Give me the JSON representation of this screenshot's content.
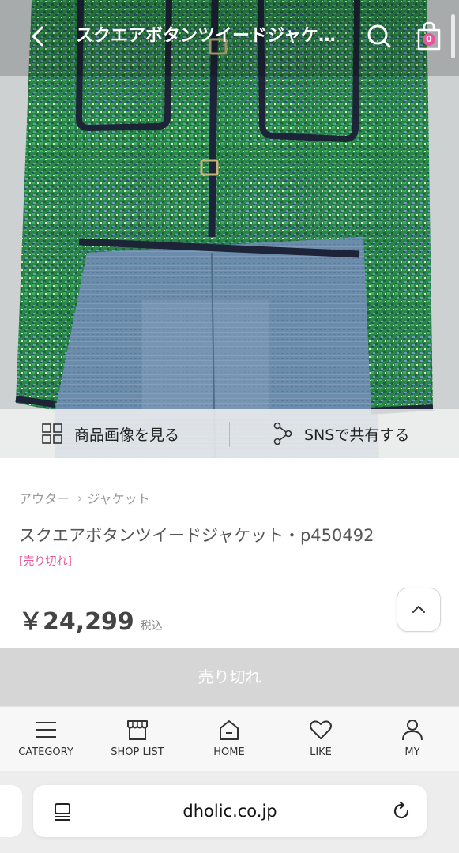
{
  "header": {
    "title": "スクエアボタンツイードジャケット",
    "cart_count": "0"
  },
  "image_actions": {
    "view_images": "商品画像を見る",
    "share_sns": "SNSで共有する"
  },
  "product": {
    "breadcrumb": [
      "アウター",
      "ジャケット"
    ],
    "name": "スクエアボタンツイードジャケット・p450492",
    "soldout_tag": "[売り切れ]",
    "price": "￥24,299",
    "tax_label": "税込"
  },
  "soldout_button": "売り切れ",
  "bottom_nav": [
    {
      "label": "CATEGORY",
      "icon": "menu-icon"
    },
    {
      "label": "SHOP LIST",
      "icon": "shop-icon"
    },
    {
      "label": "HOME",
      "icon": "home-icon"
    },
    {
      "label": "LIKE",
      "icon": "heart-icon"
    },
    {
      "label": "MY",
      "icon": "user-icon"
    }
  ],
  "browser": {
    "url": "dholic.co.jp"
  },
  "colors": {
    "accent_pink": "#e8559a",
    "tweed_green": "#2f8a4a",
    "denim_blue": "#6f8fae"
  }
}
